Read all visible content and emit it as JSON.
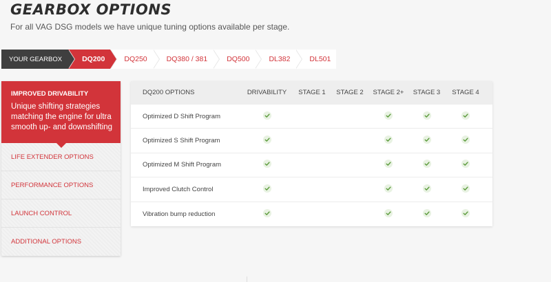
{
  "header": {
    "title": "GEARBOX OPTIONS",
    "subtitle": "For all VAG DSG models we have unique tuning options available per stage."
  },
  "breadcrumb": {
    "label": "YOUR GEARBOX",
    "items": [
      "DQ200",
      "DQ250",
      "DQ380 / 381",
      "DQ500",
      "DL382",
      "DL501"
    ],
    "active": "DQ200"
  },
  "menu": {
    "active": {
      "title": "IMPROVED DRIVABILITY",
      "description": "Unique shifting strategies matching the engine for ultra smooth up- and downshifting"
    },
    "items": [
      "LIFE EXTENDER OPTIONS",
      "PERFORMANCE OPTIONS",
      "LAUNCH CONTROL",
      "ADDITIONAL OPTIONS"
    ]
  },
  "table": {
    "columns": [
      "DQ200 OPTIONS",
      "DRIVABILITY",
      "STAGE 1",
      "STAGE 2",
      "STAGE 2+",
      "STAGE 3",
      "STAGE 4"
    ],
    "rows": [
      {
        "name": "Optimized D Shift Program",
        "checks": [
          true,
          false,
          false,
          true,
          true,
          true
        ]
      },
      {
        "name": "Optimized S Shift Program",
        "checks": [
          true,
          false,
          false,
          true,
          true,
          true
        ]
      },
      {
        "name": "Optimized M Shift Program",
        "checks": [
          true,
          false,
          false,
          true,
          true,
          true
        ]
      },
      {
        "name": "Improved Clutch Control",
        "checks": [
          true,
          false,
          false,
          true,
          true,
          true
        ]
      },
      {
        "name": "Vibration bump reduction",
        "checks": [
          true,
          false,
          false,
          true,
          true,
          true
        ]
      }
    ]
  },
  "colors": {
    "accent": "#d2343a",
    "dark": "#3f3f3f",
    "check": "#5a9a3a",
    "check_bg": "#e8f2e2"
  },
  "icons": {
    "check": "check-icon"
  }
}
